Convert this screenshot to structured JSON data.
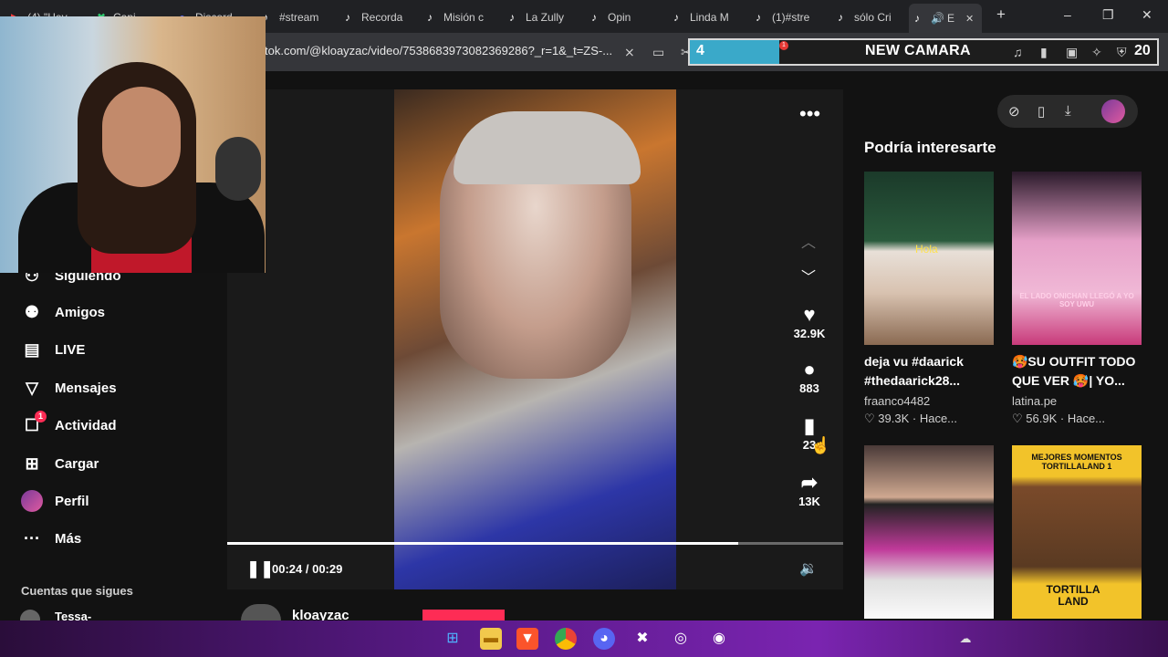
{
  "tabs": [
    {
      "label": "(4) \"Hey"
    },
    {
      "label": "Capi"
    },
    {
      "label": "Discord"
    },
    {
      "label": "#stream"
    },
    {
      "label": "Recorda"
    },
    {
      "label": "Misión c"
    },
    {
      "label": "La Zully"
    },
    {
      "label": "Opin"
    },
    {
      "label": "Linda M"
    },
    {
      "label": "(1)#stre"
    },
    {
      "label": "sólo Cri"
    },
    {
      "label": "E"
    }
  ],
  "window": {
    "new_tab": "+",
    "minimize": "–",
    "maximize": "❐",
    "close": "✕",
    "tab_close": "✕"
  },
  "address": {
    "url": "tok.com/@kloayzac/video/7538683973082369286?_r=1&_t=ZS-..."
  },
  "overlay": {
    "number": "4",
    "title": "NEW CAMARA",
    "count": "20",
    "badge": "1"
  },
  "sidebar": {
    "items": [
      {
        "label": "Siguiendo",
        "icon": "following-icon"
      },
      {
        "label": "Amigos",
        "icon": "friends-icon"
      },
      {
        "label": "LIVE",
        "icon": "live-icon"
      },
      {
        "label": "Mensajes",
        "icon": "messages-icon"
      },
      {
        "label": "Actividad",
        "icon": "activity-icon",
        "badge": "1"
      },
      {
        "label": "Cargar",
        "icon": "upload-icon"
      },
      {
        "label": "Perfil",
        "icon": "avatar"
      },
      {
        "label": "Más",
        "icon": "more-icon"
      }
    ],
    "following_header": "Cuentas que sigues",
    "following_first": "Tessa-"
  },
  "player": {
    "time": "00:24 / 00:29",
    "progress": 0.83,
    "likes": "32.9K",
    "comments": "883",
    "saves": "23",
    "shares": "13K",
    "author": "kloayzac"
  },
  "recommended": {
    "header": "Podría interesarte",
    "cards": [
      {
        "caption": "deja vu #daarick #thedaarick28...",
        "user": "fraanco4482",
        "likes": "39.3K",
        "time": "Hace...",
        "overlay_text": "Hola"
      },
      {
        "caption": "🥵SU OUTFIT TODO QUE VER 🥵| YO...",
        "user": "latina.pe",
        "likes": "56.9K",
        "time": "Hace...",
        "overlay_text": "EL LADO ONICHAN LLEGÓ A YO SOY UWU"
      },
      {
        "overlay_text": ""
      },
      {
        "overlay_text": "MEJORES MOMENTOS TORTILLALAND 1",
        "overlay_text2": "TORTILLA LAND"
      }
    ]
  },
  "colors": {
    "accent": "#fe2c55",
    "overlay_fill": "#3aa9c9",
    "bg": "#121212"
  }
}
